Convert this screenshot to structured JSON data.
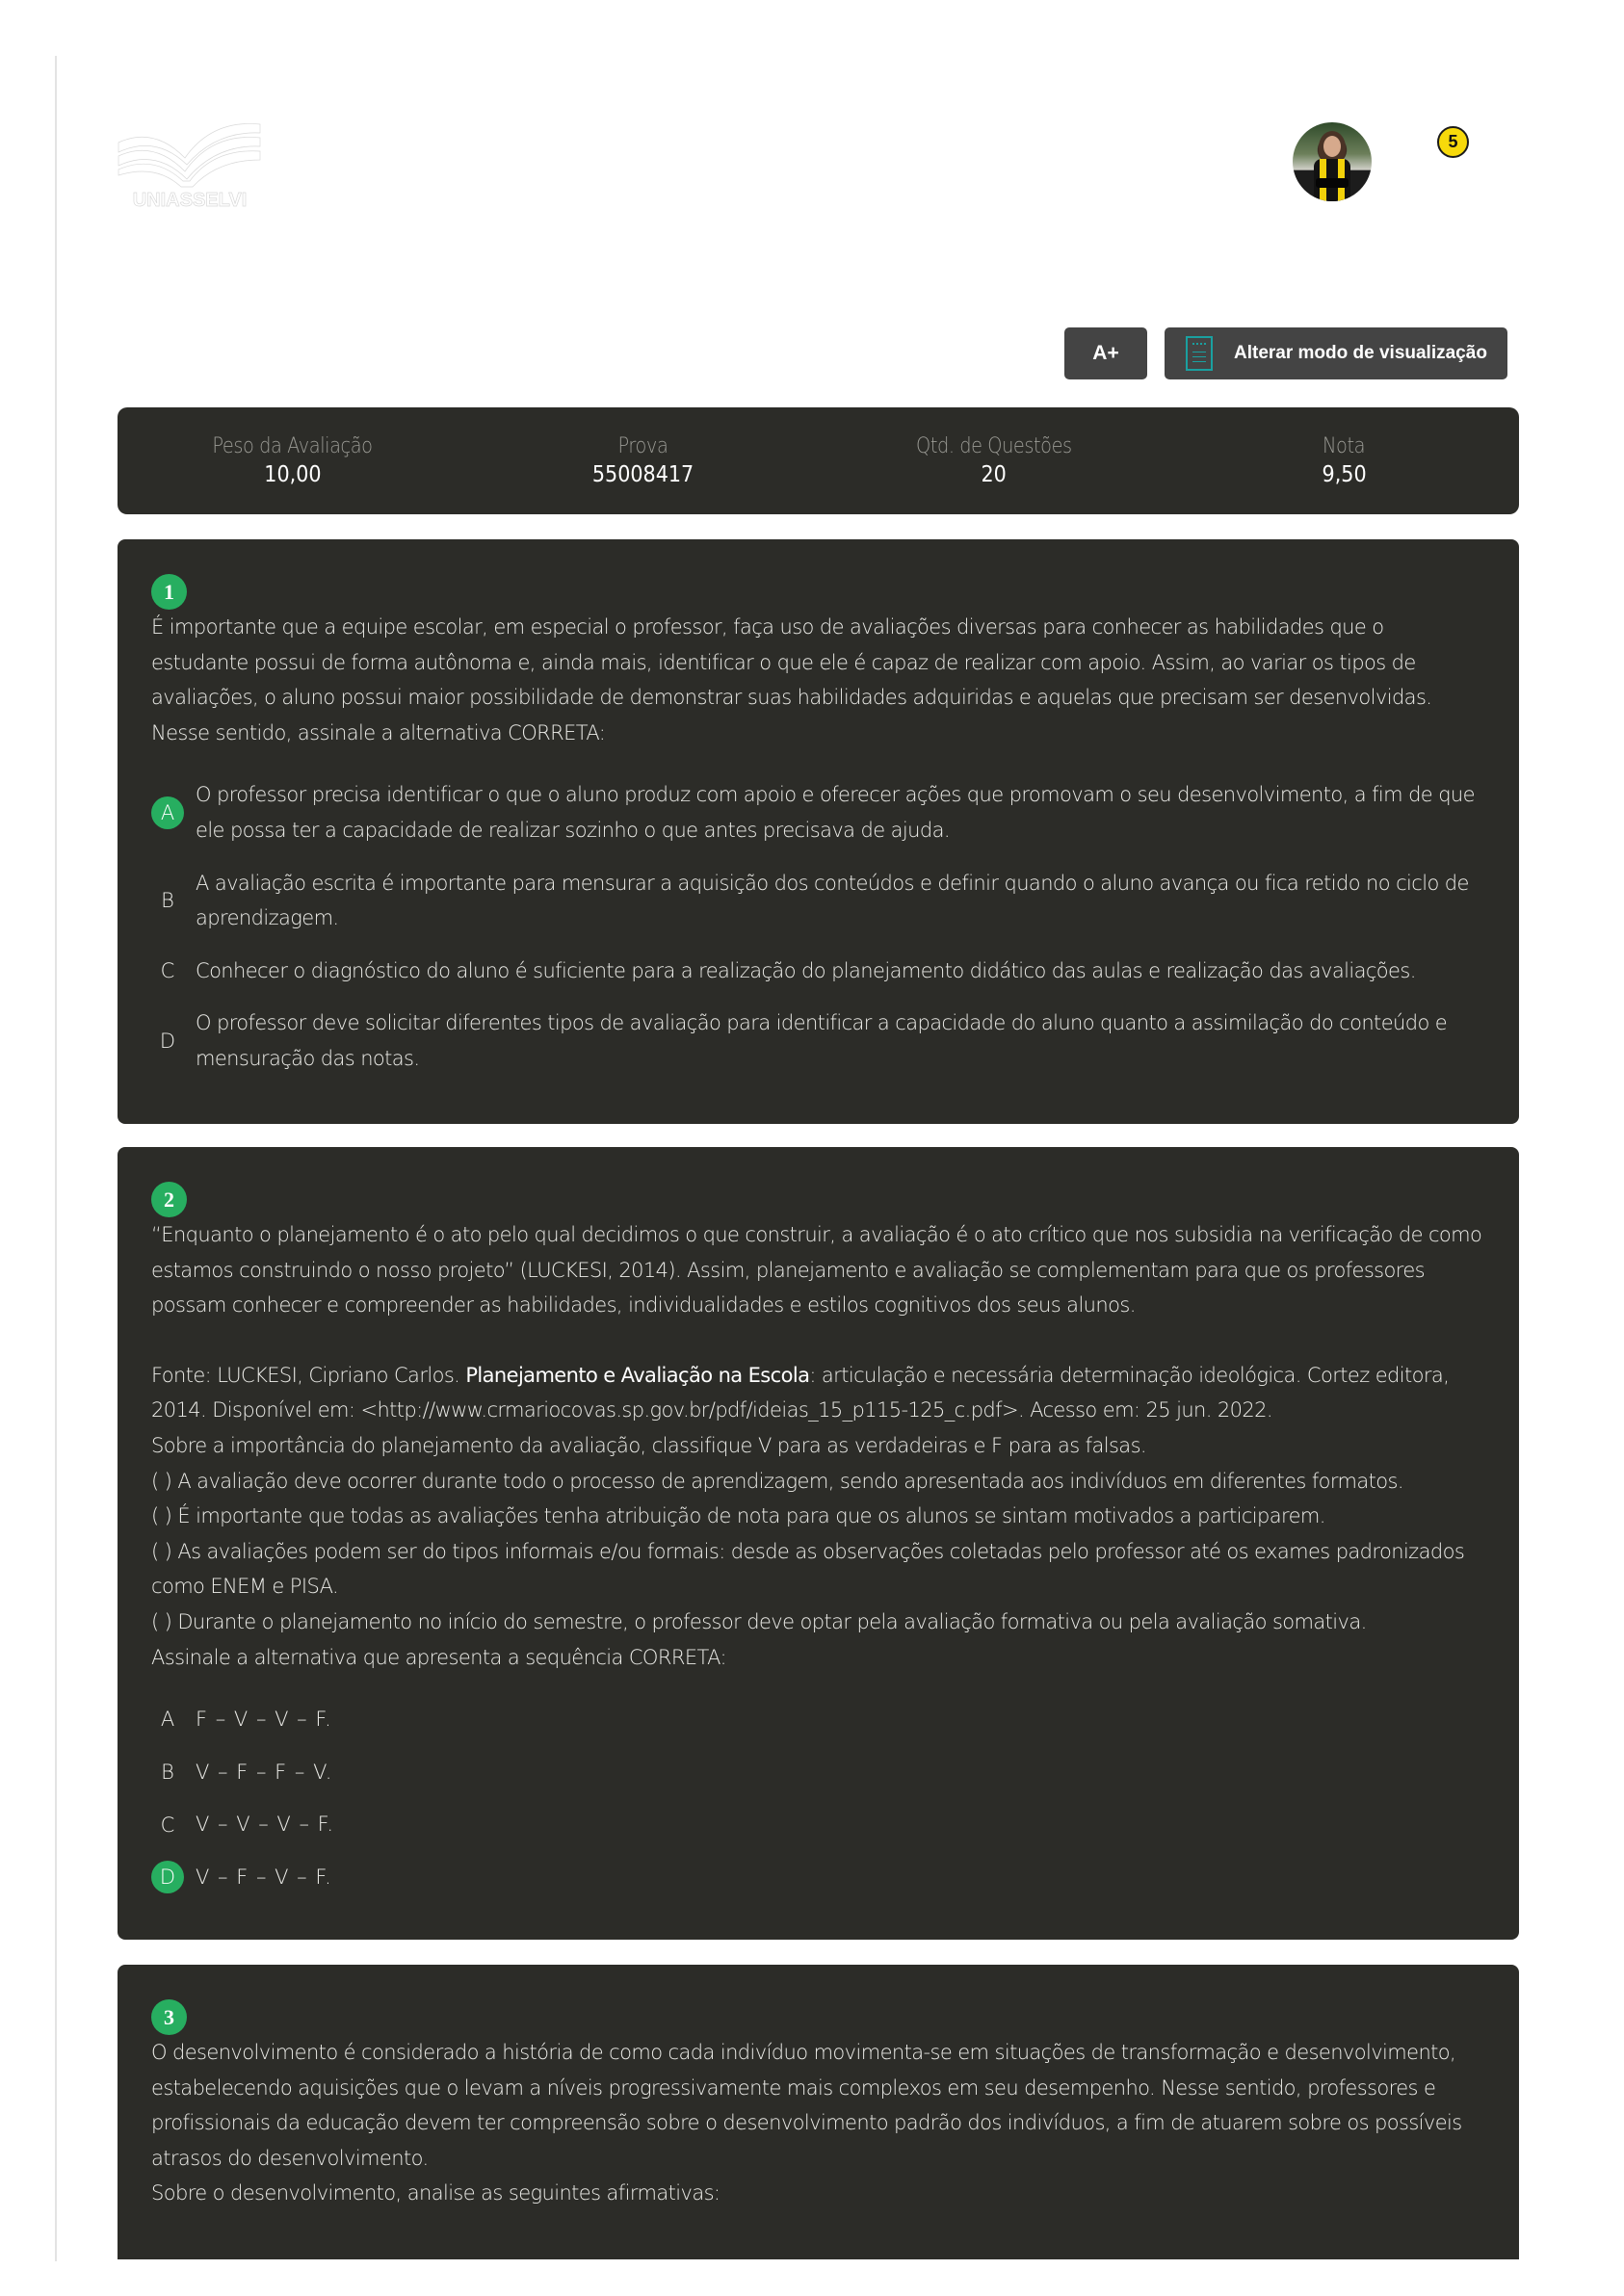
{
  "header": {
    "logo_alt": "UNIASSELVI",
    "avatar_alt": "User profile photo",
    "notification_count": "5"
  },
  "toolbar": {
    "font_size_label": "A+",
    "view_mode_label": "Alterar modo de visualização"
  },
  "summary": [
    {
      "label": "Peso da Avaliação",
      "value": "10,00"
    },
    {
      "label": "Prova",
      "value": "55008417"
    },
    {
      "label": "Qtd. de Questões",
      "value": "20"
    },
    {
      "label": "Nota",
      "value": "9,50"
    }
  ],
  "colors": {
    "card_bg": "#2c2c28",
    "accent_green": "#27ae60",
    "badge_yellow": "#f7d90b",
    "button_bg": "#444444"
  },
  "questions": [
    {
      "number": "1",
      "paragraphs": [
        "É importante que a equipe escolar, em especial o professor, faça uso de avaliações diversas para conhecer as habilidades que o estudante possui de forma autônoma e, ainda mais, identificar o que ele é capaz de realizar com apoio. Assim, ao variar os tipos de avaliações, o aluno possui maior possibilidade de demonstrar suas habilidades adquiridas e aquelas que precisam ser desenvolvidas.",
        " Nesse sentido, assinale a alternativa CORRETA:"
      ],
      "alternatives": [
        {
          "letter": "A",
          "text": " O professor precisa identificar o que o aluno produz com apoio e oferecer ações que promovam o seu desenvolvimento, a fim de que ele possa ter a capacidade de realizar sozinho o que antes precisava de ajuda.",
          "selected": true
        },
        {
          "letter": "B",
          "text": " A avaliação escrita é importante para mensurar a aquisição dos conteúdos e definir quando o aluno avança ou fica retido no ciclo de aprendizagem.",
          "selected": false
        },
        {
          "letter": "C",
          "text": " Conhecer o diagnóstico do aluno é suficiente para a realização do planejamento didático das aulas e realização das avaliações.",
          "selected": false
        },
        {
          "letter": "D",
          "text": " O professor deve solicitar diferentes tipos de avaliação para identificar a capacidade do aluno quanto a assimilação do conteúdo e mensuração das notas.",
          "selected": false
        }
      ]
    },
    {
      "number": "2",
      "intro": "“Enquanto o planejamento é o ato pelo qual decidimos o que construir, a avaliação é o ato crítico que nos subsidia na verificação de como estamos construindo o nosso projeto” (LUCKESI, 2014). Assim, planejamento e avaliação se complementam para que os professores possam conhecer e compreender as habilidades, individualidades e estilos cognitivos dos seus alunos.",
      "source_prefix": "Fonte: LUCKESI, Cipriano Carlos. ",
      "source_title": "Planejamento e Avaliação na Escola",
      "source_suffix": ": articulação e necessária determinação ideológica. Cortez editora, 2014. Disponível em: <http://www.crmariocovas.sp.gov.br/pdf/ideias_15_p115-125_c.pdf>. Acesso em: 25 jun. 2022.",
      "lines": [
        " Sobre a importância do planejamento da avaliação, classifique V para as verdadeiras e F para as falsas.",
        "( ) A avaliação deve ocorrer durante todo o processo de aprendizagem, sendo apresentada aos indivíduos em diferentes formatos.",
        "(    ) É importante que todas as avaliações tenha atribuição de nota para que os alunos se sintam motivados a participarem.",
        "(    ) As avaliações podem ser do tipos informais e/ou formais: desde as observações coletadas pelo professor até os exames padronizados como ENEM e PISA.",
        "(    ) Durante o planejamento no início do semestre,  o professor deve optar pela  avaliação formativa ou pela avaliação somativa.",
        "Assinale a alternativa que apresenta a sequência CORRETA:"
      ],
      "alternatives": [
        {
          "letter": "A",
          "text": " F – V – V – F.",
          "selected": false
        },
        {
          "letter": "B",
          "text": "V – F – F – V.",
          "selected": false
        },
        {
          "letter": "C",
          "text": "V – V – V – F.",
          "selected": false
        },
        {
          "letter": "D",
          "text": "V – F – V – F.",
          "selected": true
        }
      ]
    },
    {
      "number": "3",
      "paragraphs": [
        "O desenvolvimento é considerado a história de como cada indivíduo movimenta-se em situações de transformação e desenvolvimento, estabelecendo aquisições que o levam a níveis progressivamente mais complexos em seu desempenho. Nesse sentido, professores e profissionais da educação devem ter compreensão sobre o desenvolvimento padrão dos indivíduos, a fim de atuarem sobre os possíveis atrasos do desenvolvimento.",
        " Sobre o desenvolvimento, analise as seguintes afirmativas:"
      ]
    }
  ]
}
